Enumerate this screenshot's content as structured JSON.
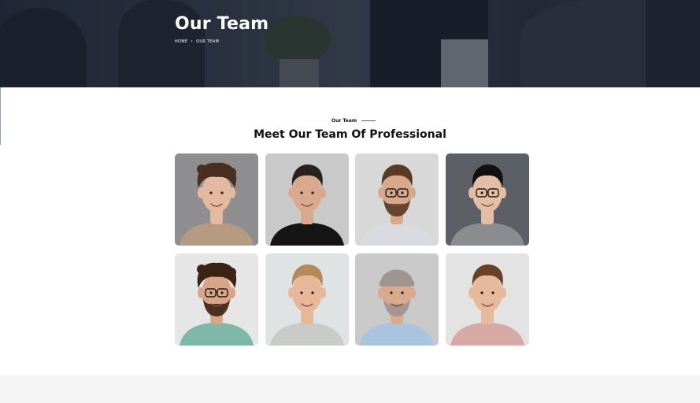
{
  "hero": {
    "title": "Our Team",
    "breadcrumb": {
      "home": "HOME",
      "separator": "›",
      "current": "OUR TEAM"
    }
  },
  "section": {
    "eyebrow": "Our Team",
    "title": "Meet Our Team Of Professional"
  },
  "team": [
    {
      "bg": "#8e8e90",
      "shirt": "#b79a82",
      "skin": "#e3b9a0",
      "hair": "#4a2e1e",
      "style": "curly"
    },
    {
      "bg": "#c9c9c9",
      "shirt": "#151515",
      "skin": "#d9a98e",
      "hair": "#2a2220",
      "style": "short"
    },
    {
      "bg": "#d8d8d8",
      "shirt": "#d9dbe0",
      "skin": "#d8a88a",
      "hair": "#5a3a22",
      "style": "glasses-beard"
    },
    {
      "bg": "#5c6066",
      "shirt": "#8a8c90",
      "skin": "#e2bea4",
      "hair": "#111111",
      "style": "glasses"
    },
    {
      "bg": "#e6e6e6",
      "shirt": "#7fb8a8",
      "skin": "#d9a586",
      "hair": "#3b2416",
      "style": "curly-glasses"
    },
    {
      "bg": "#dfe3e4",
      "shirt": "#c8cbc7",
      "skin": "#e7b79a",
      "hair": "#b48a58",
      "style": "short"
    },
    {
      "bg": "#c9c9c9",
      "shirt": "#a9c4de",
      "skin": "#d9a98e",
      "hair": "#9c9590",
      "style": "beanie-beard"
    },
    {
      "bg": "#e3e3e3",
      "shirt": "#d6a9a4",
      "skin": "#e7b99c",
      "hair": "#6a4126",
      "style": "short"
    }
  ],
  "colors": {
    "accent": "#2f5bd8",
    "heroOverlay": "#2b3140",
    "footerBand": "#f5f5f5"
  }
}
